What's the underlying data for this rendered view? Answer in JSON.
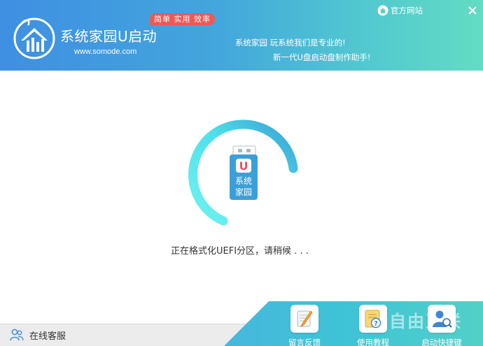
{
  "header": {
    "app_title": "系统家园U启动",
    "app_url": "www.somode.com",
    "badge": "简单 实用 效率",
    "slogan_line1": "系统家园 玩系统我们是专业的!",
    "slogan_line2": "新一代U盘启动盘制作助手!",
    "official_site": "官方网站"
  },
  "main": {
    "usb_badge_letter": "U",
    "usb_label_line1": "系统",
    "usb_label_line2": "家园",
    "status": "正在格式化UEFI分区，请稍候 . . ."
  },
  "footer": {
    "online_service": "在线客服",
    "tools": [
      {
        "label": "留言反馈",
        "icon": "feedback-icon"
      },
      {
        "label": "使用教程",
        "icon": "tutorial-icon"
      },
      {
        "label": "启动快捷键",
        "icon": "hotkey-icon"
      }
    ],
    "watermark": "自由互联"
  },
  "colors": {
    "header_start": "#3f8fe2",
    "header_end": "#63dcc3",
    "badge": "#ea5a57",
    "spinner_light": "#57ecee",
    "spinner_dark": "#3aa3d6",
    "usb_body": "#3ba0d8"
  }
}
